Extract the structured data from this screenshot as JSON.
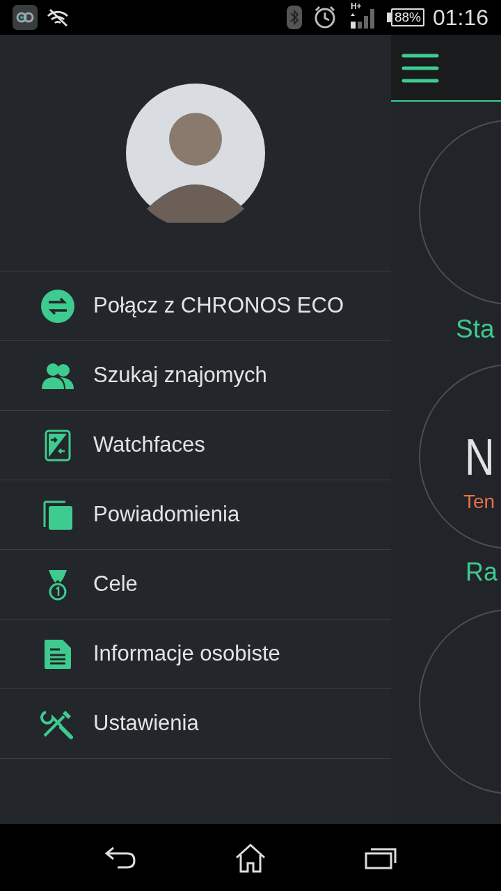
{
  "status_bar": {
    "network_type": "H+",
    "battery": "88%",
    "time": "01:16"
  },
  "drawer": {
    "menu_items": [
      {
        "label": "Połącz z CHRONOS ECO"
      },
      {
        "label": "Szukaj znajomych"
      },
      {
        "label": "Watchfaces"
      },
      {
        "label": "Powiadomienia"
      },
      {
        "label": "Cele"
      },
      {
        "label": "Informacje osobiste"
      },
      {
        "label": "Ustawienia"
      }
    ]
  },
  "background_screen": {
    "heading_1": "Sta",
    "circle_2_value": "N",
    "circle_2_caption": "Ten",
    "heading_2": "Ra"
  }
}
